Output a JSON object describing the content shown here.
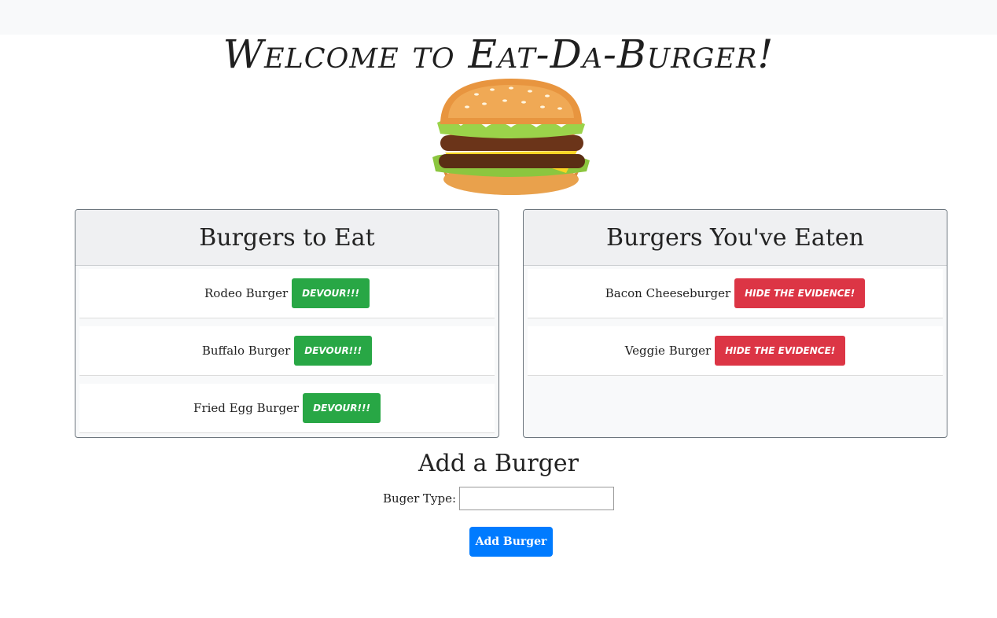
{
  "header": {
    "welcome_text": "Welcome to Eat-Da-Burger!"
  },
  "to_eat": {
    "title": "Burgers to Eat",
    "items": [
      {
        "name": "Rodeo Burger",
        "button": "Devour!!!"
      },
      {
        "name": "Buffalo Burger",
        "button": "Devour!!!"
      },
      {
        "name": "Fried Egg Burger",
        "button": "Devour!!!"
      }
    ]
  },
  "eaten": {
    "title": "Burgers You've Eaten",
    "items": [
      {
        "name": "Bacon Cheeseburger",
        "button": "Hide the Evidence!"
      },
      {
        "name": "Veggie Burger",
        "button": "Hide the Evidence!"
      }
    ]
  },
  "add_form": {
    "title": "Add a Burger",
    "label": "Buger Type:",
    "input_value": "",
    "submit_label": "Add Burger"
  },
  "colors": {
    "devour": "#28a745",
    "hide": "#dc3545",
    "primary": "#007bff"
  }
}
